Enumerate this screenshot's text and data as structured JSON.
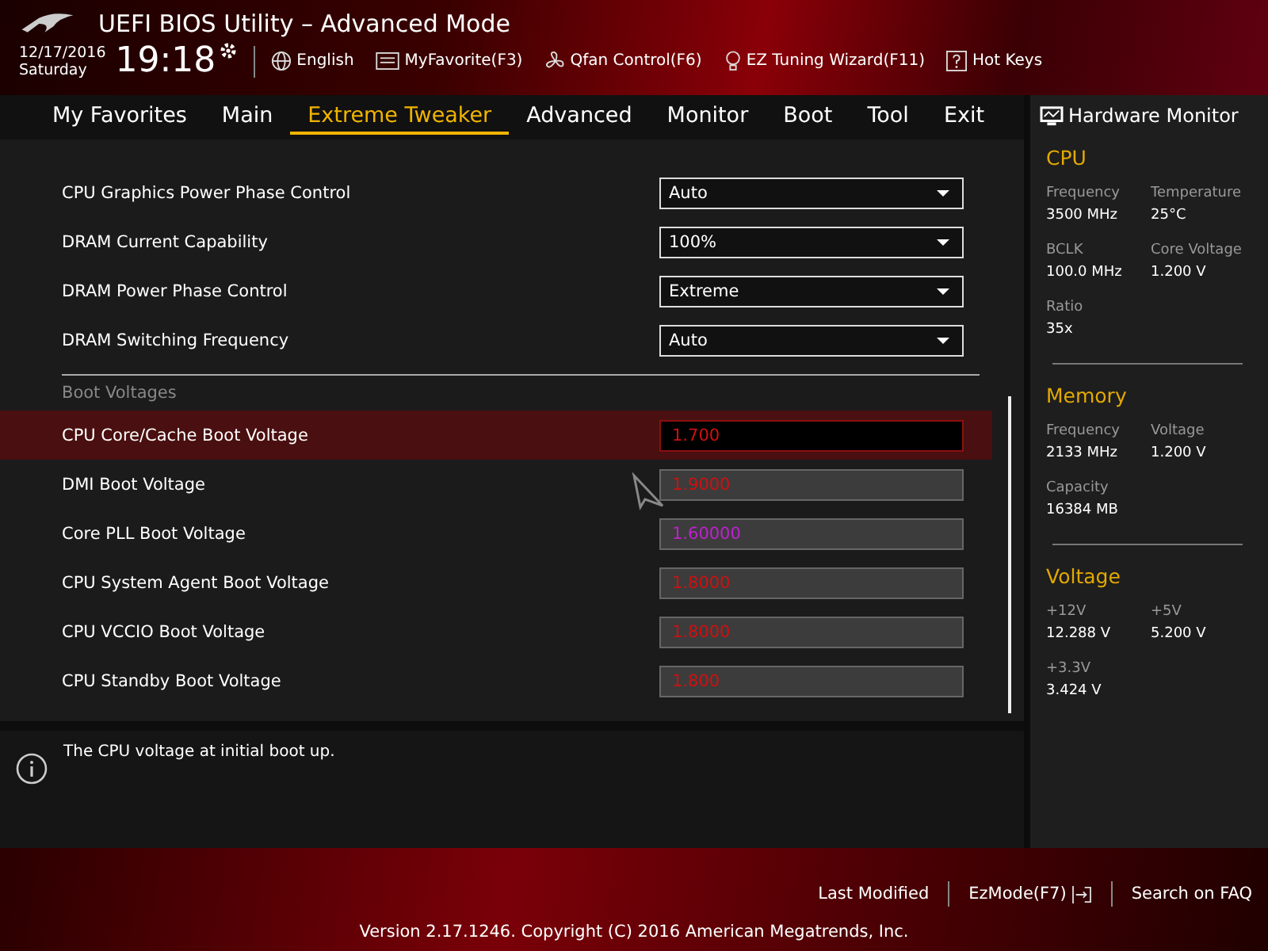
{
  "header": {
    "title": "UEFI BIOS Utility – Advanced Mode",
    "date": "12/17/2016",
    "day": "Saturday",
    "time": "19:18",
    "tools": [
      {
        "kind": "globe",
        "label": "English"
      },
      {
        "kind": "favorite",
        "label": "MyFavorite(F3)"
      },
      {
        "kind": "fan",
        "label": "Qfan Control(F6)"
      },
      {
        "kind": "bulb",
        "label": "EZ Tuning Wizard(F11)"
      },
      {
        "kind": "help",
        "label": "Hot Keys"
      }
    ]
  },
  "tabs": [
    {
      "label": "My Favorites",
      "selected": false
    },
    {
      "label": "Main",
      "selected": false
    },
    {
      "label": "Extreme Tweaker",
      "selected": true
    },
    {
      "label": "Advanced",
      "selected": false
    },
    {
      "label": "Monitor",
      "selected": false
    },
    {
      "label": "Boot",
      "selected": false
    },
    {
      "label": "Tool",
      "selected": false
    },
    {
      "label": "Exit",
      "selected": false
    }
  ],
  "settings": [
    {
      "kind": "dropdown",
      "label": "CPU Graphics Power Phase Control",
      "value": "Auto",
      "selected": false
    },
    {
      "kind": "dropdown",
      "label": "DRAM Current Capability",
      "value": "100%",
      "selected": false
    },
    {
      "kind": "dropdown",
      "label": "DRAM Power Phase Control",
      "value": "Extreme",
      "selected": false
    },
    {
      "kind": "dropdown",
      "label": "DRAM Switching Frequency",
      "value": "Auto",
      "selected": false
    },
    {
      "kind": "section",
      "label": "Boot Voltages"
    },
    {
      "kind": "input",
      "label": "CPU Core/Cache Boot Voltage",
      "value": "1.700",
      "color": "#d01010",
      "selected": true
    },
    {
      "kind": "input",
      "label": "DMI Boot Voltage",
      "value": "1.9000",
      "color": "#d01010",
      "selected": false
    },
    {
      "kind": "input",
      "label": "Core PLL Boot Voltage",
      "value": "1.60000",
      "color": "#c020d0",
      "selected": false
    },
    {
      "kind": "input",
      "label": "CPU System Agent Boot Voltage",
      "value": "1.8000",
      "color": "#d01010",
      "selected": false
    },
    {
      "kind": "input",
      "label": "CPU VCCIO Boot Voltage",
      "value": "1.8000",
      "color": "#d01010",
      "selected": false
    },
    {
      "kind": "input",
      "label": "CPU Standby Boot Voltage",
      "value": "1.800",
      "color": "#d01010",
      "selected": false
    }
  ],
  "help_text": "The CPU voltage at initial boot up.",
  "hardware_monitor": {
    "title": "Hardware Monitor",
    "sections": [
      {
        "title": "CPU",
        "items": [
          {
            "label": "Frequency",
            "value": "3500 MHz"
          },
          {
            "label": "Temperature",
            "value": "25°C"
          },
          {
            "label": "BCLK",
            "value": "100.0 MHz"
          },
          {
            "label": "Core Voltage",
            "value": "1.200 V"
          },
          {
            "label": "Ratio",
            "value": "35x"
          }
        ]
      },
      {
        "title": "Memory",
        "items": [
          {
            "label": "Frequency",
            "value": "2133 MHz"
          },
          {
            "label": "Voltage",
            "value": "1.200 V"
          },
          {
            "label": "Capacity",
            "value": "16384 MB"
          }
        ]
      },
      {
        "title": "Voltage",
        "items": [
          {
            "label": "+12V",
            "value": "12.288 V"
          },
          {
            "label": "+5V",
            "value": "5.200 V"
          },
          {
            "label": "+3.3V",
            "value": "3.424 V"
          }
        ]
      }
    ]
  },
  "footer": {
    "links": [
      "Last Modified",
      "EzMode(F7)",
      "Search on FAQ"
    ],
    "version": "Version 2.17.1246. Copyright (C) 2016 American Megatrends, Inc."
  }
}
